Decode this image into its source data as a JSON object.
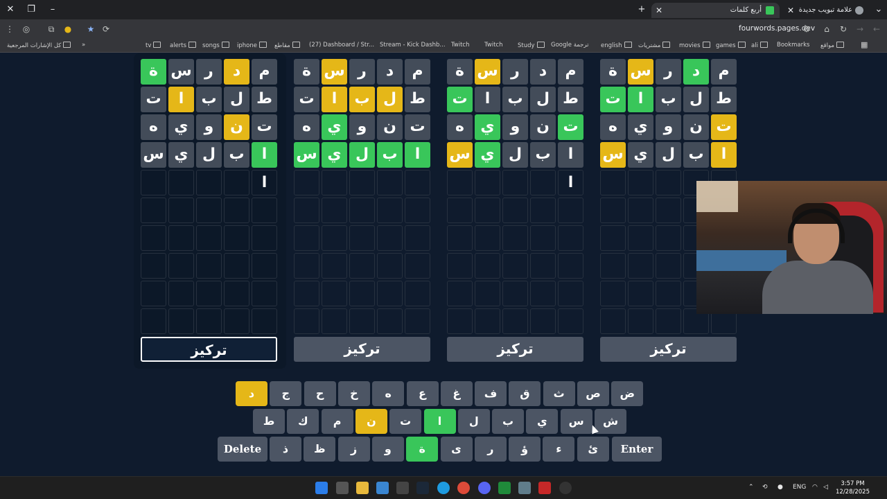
{
  "browser": {
    "tabs": [
      {
        "label": "أربع كلمات",
        "active": true
      },
      {
        "label": "علامة تبويب جديدة",
        "active": false
      }
    ],
    "url": "fourwords.pages.dev",
    "bookmarks": [
      "كل الإشارات المرجعية",
      "tv",
      "alerts",
      "songs",
      "iphone",
      "مقاطع",
      "(27) Dashboard / Str...",
      "Stream - Kick Dashb...",
      "Twitch",
      "Twitch",
      "Study",
      "Google ترجمة",
      "english",
      "مشتريات",
      "movies",
      "games",
      "ali",
      "Bookmarks",
      "مواقع"
    ]
  },
  "boards": [
    {
      "rows": [
        [
          {
            "c": "ة",
            "s": "g"
          },
          {
            "c": "س",
            "s": "d"
          },
          {
            "c": "ر",
            "s": "d"
          },
          {
            "c": "د",
            "s": "y"
          },
          {
            "c": "م",
            "s": "d"
          }
        ],
        [
          {
            "c": "ت",
            "s": "d"
          },
          {
            "c": "ا",
            "s": "y"
          },
          {
            "c": "ب",
            "s": "d"
          },
          {
            "c": "ل",
            "s": "d"
          },
          {
            "c": "ط",
            "s": "d"
          }
        ],
        [
          {
            "c": "ه",
            "s": "d"
          },
          {
            "c": "ي",
            "s": "d"
          },
          {
            "c": "و",
            "s": "d"
          },
          {
            "c": "ن",
            "s": "y"
          },
          {
            "c": "ت",
            "s": "d"
          }
        ],
        [
          {
            "c": "س",
            "s": "d"
          },
          {
            "c": "ي",
            "s": "d"
          },
          {
            "c": "ل",
            "s": "d"
          },
          {
            "c": "ب",
            "s": "d"
          },
          {
            "c": "ا",
            "s": "g"
          }
        ],
        [
          {
            "c": "",
            "s": "e"
          },
          {
            "c": "",
            "s": "e"
          },
          {
            "c": "",
            "s": "e"
          },
          {
            "c": "",
            "s": "e"
          },
          {
            "c": "ا",
            "s": "e"
          }
        ]
      ],
      "focus_label": "تركيز"
    },
    {
      "rows": [
        [
          {
            "c": "ة",
            "s": "d"
          },
          {
            "c": "س",
            "s": "y"
          },
          {
            "c": "ر",
            "s": "d"
          },
          {
            "c": "د",
            "s": "d"
          },
          {
            "c": "م",
            "s": "d"
          }
        ],
        [
          {
            "c": "ت",
            "s": "d"
          },
          {
            "c": "ا",
            "s": "y"
          },
          {
            "c": "ب",
            "s": "y"
          },
          {
            "c": "ل",
            "s": "y"
          },
          {
            "c": "ط",
            "s": "d"
          }
        ],
        [
          {
            "c": "ه",
            "s": "d"
          },
          {
            "c": "ي",
            "s": "g"
          },
          {
            "c": "و",
            "s": "d"
          },
          {
            "c": "ن",
            "s": "d"
          },
          {
            "c": "ت",
            "s": "d"
          }
        ],
        [
          {
            "c": "س",
            "s": "g"
          },
          {
            "c": "ي",
            "s": "g"
          },
          {
            "c": "ل",
            "s": "g"
          },
          {
            "c": "ب",
            "s": "g"
          },
          {
            "c": "ا",
            "s": "g"
          }
        ],
        [
          {
            "c": "",
            "s": "e"
          },
          {
            "c": "",
            "s": "e"
          },
          {
            "c": "",
            "s": "e"
          },
          {
            "c": "",
            "s": "e"
          },
          {
            "c": "",
            "s": "e"
          }
        ]
      ],
      "focus_label": "تركيز"
    },
    {
      "rows": [
        [
          {
            "c": "ة",
            "s": "d"
          },
          {
            "c": "س",
            "s": "y"
          },
          {
            "c": "ر",
            "s": "d"
          },
          {
            "c": "د",
            "s": "d"
          },
          {
            "c": "م",
            "s": "d"
          }
        ],
        [
          {
            "c": "ت",
            "s": "g"
          },
          {
            "c": "ا",
            "s": "d"
          },
          {
            "c": "ب",
            "s": "d"
          },
          {
            "c": "ل",
            "s": "d"
          },
          {
            "c": "ط",
            "s": "d"
          }
        ],
        [
          {
            "c": "ه",
            "s": "d"
          },
          {
            "c": "ي",
            "s": "g"
          },
          {
            "c": "و",
            "s": "d"
          },
          {
            "c": "ن",
            "s": "d"
          },
          {
            "c": "ت",
            "s": "g"
          }
        ],
        [
          {
            "c": "س",
            "s": "y"
          },
          {
            "c": "ي",
            "s": "g"
          },
          {
            "c": "ل",
            "s": "d"
          },
          {
            "c": "ب",
            "s": "d"
          },
          {
            "c": "ا",
            "s": "d"
          }
        ],
        [
          {
            "c": "",
            "s": "e"
          },
          {
            "c": "",
            "s": "e"
          },
          {
            "c": "",
            "s": "e"
          },
          {
            "c": "",
            "s": "e"
          },
          {
            "c": "ا",
            "s": "e"
          }
        ]
      ],
      "focus_label": "تركيز"
    },
    {
      "rows": [
        [
          {
            "c": "ة",
            "s": "d"
          },
          {
            "c": "س",
            "s": "y"
          },
          {
            "c": "ر",
            "s": "d"
          },
          {
            "c": "د",
            "s": "g"
          },
          {
            "c": "م",
            "s": "d"
          }
        ],
        [
          {
            "c": "ت",
            "s": "g"
          },
          {
            "c": "ا",
            "s": "g"
          },
          {
            "c": "ب",
            "s": "d"
          },
          {
            "c": "ل",
            "s": "d"
          },
          {
            "c": "ط",
            "s": "d"
          }
        ],
        [
          {
            "c": "ه",
            "s": "d"
          },
          {
            "c": "ي",
            "s": "d"
          },
          {
            "c": "و",
            "s": "d"
          },
          {
            "c": "ن",
            "s": "d"
          },
          {
            "c": "ت",
            "s": "y"
          }
        ],
        [
          {
            "c": "س",
            "s": "y"
          },
          {
            "c": "ي",
            "s": "d"
          },
          {
            "c": "ل",
            "s": "d"
          },
          {
            "c": "ب",
            "s": "d"
          },
          {
            "c": "ا",
            "s": "y"
          }
        ],
        [
          {
            "c": "",
            "s": "e"
          },
          {
            "c": "",
            "s": "e"
          },
          {
            "c": "",
            "s": "e"
          },
          {
            "c": "",
            "s": "e"
          },
          {
            "c": "",
            "s": "e"
          }
        ]
      ],
      "focus_label": "تركيز"
    }
  ],
  "keyboard": {
    "row1": [
      {
        "k": "ض",
        "s": ""
      },
      {
        "k": "ص",
        "s": ""
      },
      {
        "k": "ث",
        "s": ""
      },
      {
        "k": "ق",
        "s": ""
      },
      {
        "k": "ف",
        "s": ""
      },
      {
        "k": "غ",
        "s": ""
      },
      {
        "k": "ع",
        "s": ""
      },
      {
        "k": "ه",
        "s": ""
      },
      {
        "k": "خ",
        "s": ""
      },
      {
        "k": "ح",
        "s": ""
      },
      {
        "k": "ج",
        "s": ""
      },
      {
        "k": "د",
        "s": "y"
      }
    ],
    "row2": [
      {
        "k": "ش",
        "s": ""
      },
      {
        "k": "س",
        "s": ""
      },
      {
        "k": "ي",
        "s": ""
      },
      {
        "k": "ب",
        "s": ""
      },
      {
        "k": "ل",
        "s": ""
      },
      {
        "k": "ا",
        "s": "g"
      },
      {
        "k": "ت",
        "s": ""
      },
      {
        "k": "ن",
        "s": "y"
      },
      {
        "k": "م",
        "s": ""
      },
      {
        "k": "ك",
        "s": ""
      },
      {
        "k": "ط",
        "s": ""
      }
    ],
    "row3": [
      {
        "k": "ئ",
        "s": ""
      },
      {
        "k": "ء",
        "s": ""
      },
      {
        "k": "ؤ",
        "s": ""
      },
      {
        "k": "ر",
        "s": ""
      },
      {
        "k": "ى",
        "s": ""
      },
      {
        "k": "ة",
        "s": "g"
      },
      {
        "k": "و",
        "s": ""
      },
      {
        "k": "ز",
        "s": ""
      },
      {
        "k": "ظ",
        "s": ""
      },
      {
        "k": "ذ",
        "s": ""
      }
    ],
    "delete_label": "Delete",
    "enter_label": "Enter"
  },
  "taskbar": {
    "lang": "ENG",
    "time": "3:57 PM",
    "date": "12/28/2025"
  },
  "colors": {
    "correct": "#39c65a",
    "present": "#e5b718",
    "absent": "#434c59",
    "background": "#0f1b2d"
  }
}
